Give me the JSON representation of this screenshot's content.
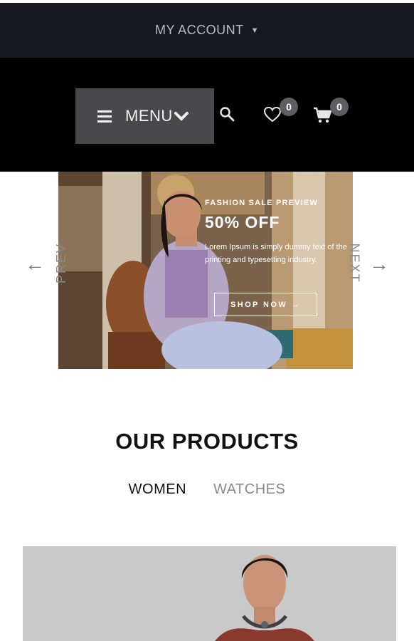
{
  "topbar": {
    "account_label": "MY ACCOUNT"
  },
  "header": {
    "menu_label": "MENU",
    "wishlist_count": "0",
    "cart_count": "0"
  },
  "slider": {
    "prev_label": "PREV",
    "next_label": "NEXT",
    "kicker": "FASHION SALE PREVIEW",
    "headline": "50% OFF",
    "description": "Lorem Ipsum is simply dummy text of the printing and typesetting industry.",
    "cta_label": "SHOP NOW →"
  },
  "products": {
    "title": "OUR PRODUCTS",
    "tabs": [
      {
        "label": "WOMEN",
        "active": true
      },
      {
        "label": "WATCHES",
        "active": false
      }
    ]
  },
  "colors": {
    "topbar_bg": "#16191f",
    "header_bg": "#000000",
    "menu_bg": "#47494c",
    "badge_bg": "#5c5e62"
  }
}
